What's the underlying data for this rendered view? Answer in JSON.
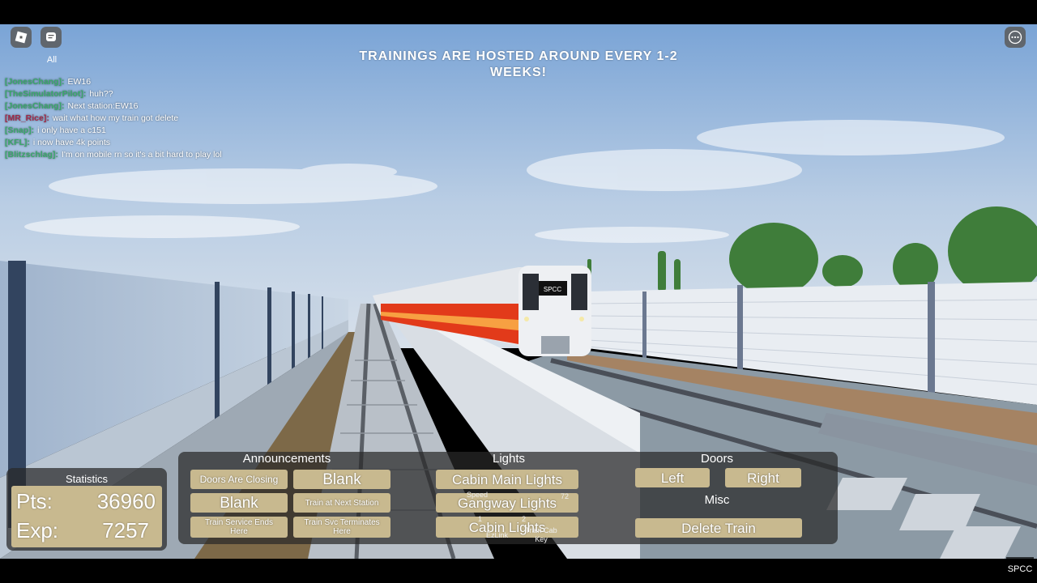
{
  "topbar": {
    "chat_filter_label": "All"
  },
  "banner": {
    "line1": "TRAININGS ARE HOSTED AROUND EVERY 1-2",
    "line2": "WEEKS!"
  },
  "chat": [
    {
      "name": "[JonesChang]:",
      "color": "#3aa86b",
      "text": "EW16"
    },
    {
      "name": "[TheSimulatorPilot]:",
      "color": "#3aa86b",
      "text": "huh??"
    },
    {
      "name": "[JonesChang]:",
      "color": "#3aa86b",
      "text": "Next station:EW16"
    },
    {
      "name": "[MR_Rice]:",
      "color": "#a02a4a",
      "text": "wait what how my train got delete"
    },
    {
      "name": "[Snap]:",
      "color": "#3aa86b",
      "text": "i only have a c151"
    },
    {
      "name": "[KFL]:",
      "color": "#3aa86b",
      "text": "i now have 4k points"
    },
    {
      "name": "[Blitzschlag]:",
      "color": "#3aa86b",
      "text": "I'm on mobile rn so it's a bit hard to play lol"
    }
  ],
  "statistics": {
    "title": "Statistics",
    "pts_label": "Pts:",
    "pts_value": "36960",
    "exp_label": "Exp:",
    "exp_value": "7257"
  },
  "announcements": {
    "title": "Announcements",
    "doors_closing": "Doors Are Closing",
    "blank1": "Blank",
    "blank2": "Blank",
    "train_next_station": "Train at Next Station",
    "service_ends_l1": "Train Service Ends",
    "service_ends_l2": "Here",
    "svc_terminates_l1": "Train Svc Terminates",
    "svc_terminates_l2": "Here"
  },
  "lights": {
    "title": "Lights",
    "cabin_main": "Cabin Main Lights",
    "gangway": "Gangway Lights",
    "cabin": "Cabin Lights"
  },
  "doors": {
    "title": "Doors",
    "left": "Left",
    "right": "Right"
  },
  "misc": {
    "title": "Misc",
    "delete_train": "Delete Train"
  },
  "train_ui": {
    "speed_label": "Speed",
    "speed_value": "72",
    "ezlink": "EzLink",
    "cab_key": "Train Cab Key",
    "slot1": "1",
    "slot2": "2"
  },
  "watermark": "SPCC",
  "train_destination": "SPCC"
}
